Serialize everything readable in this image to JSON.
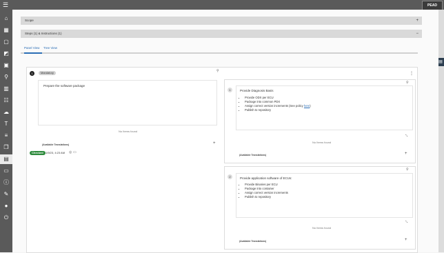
{
  "topbar": {
    "logo_text": "PEAD"
  },
  "sidebar": {
    "icons": [
      "home-icon",
      "grid-icon",
      "box-icon",
      "chart-icon",
      "calendar-icon",
      "pin-icon",
      "bars-icon",
      "list-icon",
      "cloud-icon",
      "text-icon",
      "sliders-icon",
      "layers-icon",
      "document-icon",
      "ticket-icon",
      "info-icon",
      "wrench-icon",
      "user-icon",
      "logout-icon"
    ]
  },
  "panels": {
    "scope": {
      "label": "Scope",
      "toggle": "+"
    },
    "steps": {
      "label": "Steps (1) & Instructions (1)",
      "toggle": "−"
    }
  },
  "tabs": [
    {
      "label": "Panel View"
    },
    {
      "label": "Tree View"
    }
  ],
  "step": {
    "number": "1",
    "badge": "Mandatory",
    "text": "Prepare the software package",
    "no_items": "No Items found",
    "avail": "(Available Translations)",
    "add": "+",
    "status": "Checked",
    "timestamp": "1/9/23, 4:23 AM",
    "menu": "⋮"
  },
  "instructions": [
    {
      "number": "1",
      "title": "Provide Diagnosis Basis",
      "bullets": [
        "Provide ODX per ECU",
        "Package into common PDX",
        "Assign correct version increments (See policy here)",
        "Publish to repository"
      ],
      "link_text": "here",
      "no_items": "No Items found",
      "avail": "(Available Translations)",
      "add": "+"
    },
    {
      "number": "2",
      "title": "Provide application software of ECUs:",
      "bullets": [
        "Provide Binaries per ECU",
        "Package into container",
        "Assign correct version increments",
        "Publish to repository"
      ],
      "no_items": "No Items found",
      "avail": "(Available Translations)",
      "add": "+"
    }
  ],
  "colors": {
    "sidebar": "#5a5a5a",
    "accent": "#2a6db5",
    "checked": "#2e8b3d"
  }
}
